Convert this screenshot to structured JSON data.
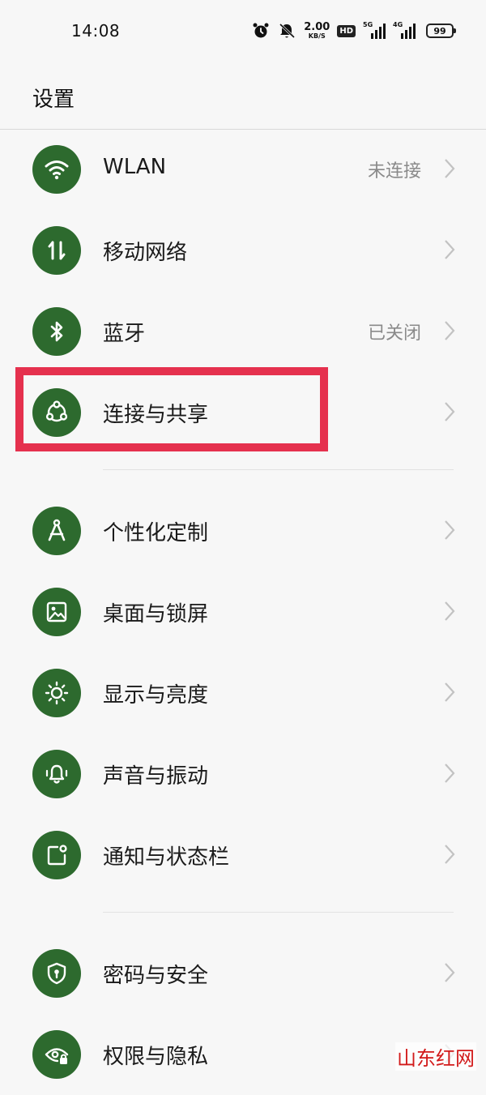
{
  "status_bar": {
    "time": "14:08",
    "speed_value": "2.00",
    "speed_unit": "KB/S",
    "hd_badge": "HD",
    "net1": "5G",
    "net2": "4G",
    "battery": "99"
  },
  "header": {
    "title": "设置"
  },
  "groups": [
    {
      "items": [
        {
          "label": "WLAN",
          "value": "未连接",
          "icon": "wifi-icon"
        },
        {
          "label": "移动网络",
          "value": "",
          "icon": "mobile-data-icon"
        },
        {
          "label": "蓝牙",
          "value": "已关闭",
          "icon": "bluetooth-icon"
        },
        {
          "label": "连接与共享",
          "value": "",
          "icon": "connection-share-icon"
        }
      ]
    },
    {
      "items": [
        {
          "label": "个性化定制",
          "value": "",
          "icon": "compass-icon"
        },
        {
          "label": "桌面与锁屏",
          "value": "",
          "icon": "wallpaper-icon"
        },
        {
          "label": "显示与亮度",
          "value": "",
          "icon": "brightness-icon"
        },
        {
          "label": "声音与振动",
          "value": "",
          "icon": "bell-vibrate-icon"
        },
        {
          "label": "通知与状态栏",
          "value": "",
          "icon": "notification-icon"
        }
      ]
    },
    {
      "items": [
        {
          "label": "密码与安全",
          "value": "",
          "icon": "shield-lock-icon"
        },
        {
          "label": "权限与隐私",
          "value": "",
          "icon": "privacy-eye-icon"
        }
      ]
    }
  ],
  "colors": {
    "icon_background": "#2d6a2e",
    "highlight": "#e5314e",
    "page_background": "#f7f7f7"
  },
  "watermark": "山东红网"
}
